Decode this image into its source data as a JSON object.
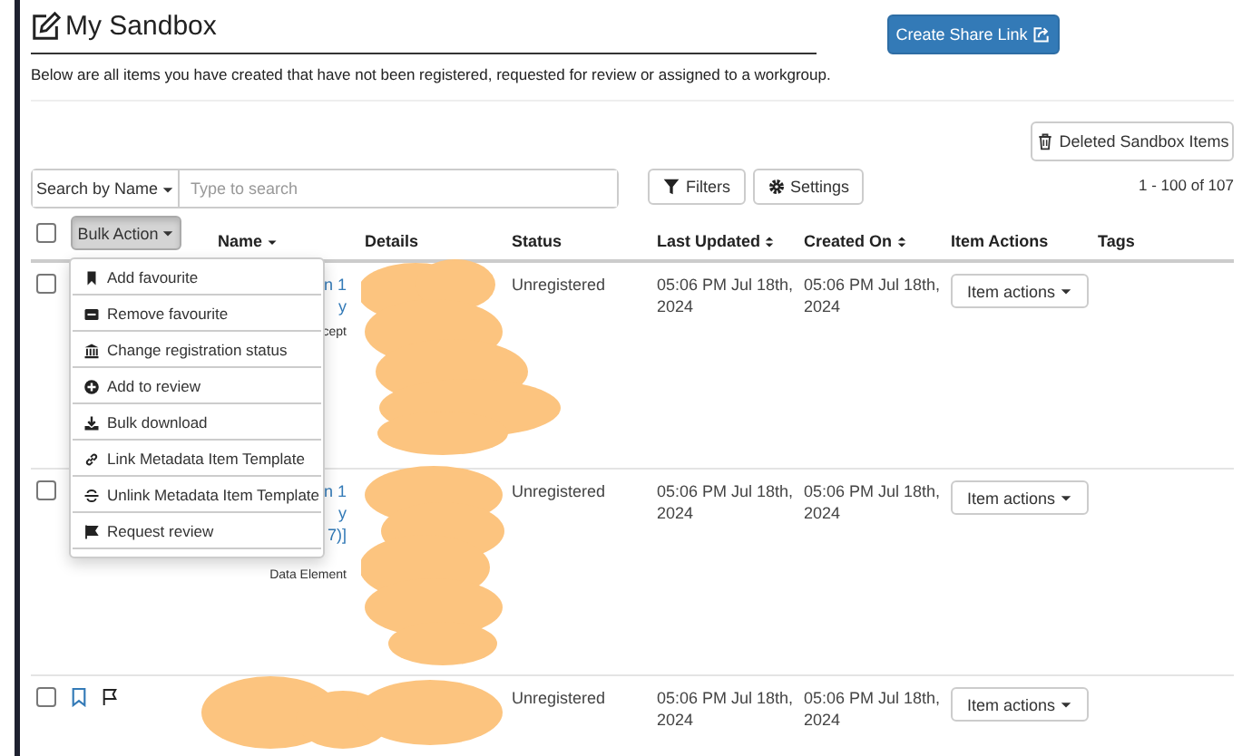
{
  "page": {
    "title": "My Sandbox",
    "description": "Below are all items you have created that have not been registered, requested for review or assigned to a workgroup.",
    "share_button": "Create Share Link",
    "deleted_button": "Deleted Sandbox Items"
  },
  "toolbar": {
    "search_mode": "Search by Name",
    "search_placeholder": "Type to search",
    "filters": "Filters",
    "settings": "Settings",
    "pagination": "1 - 100 of 107"
  },
  "table": {
    "select_all_checked": false,
    "bulk_action": "Bulk Action",
    "bulk_menu_open": true,
    "columns": [
      "Name",
      "Details",
      "Status",
      "Last Updated",
      "Created On",
      "Item Actions",
      "Tags"
    ],
    "rows": [
      {
        "checked": false,
        "redacted": true,
        "name": [
          {
            "text": "n 1",
            "kind": "link"
          },
          {
            "text": "y",
            "kind": "link"
          },
          {
            "text": "cept",
            "kind": "type"
          }
        ],
        "status": "Unregistered",
        "last_updated": "05:06 PM Jul 18th, 2024",
        "created_on": "05:06 PM Jul 18th, 2024",
        "action": "Item actions"
      },
      {
        "checked": false,
        "redacted": true,
        "name": [
          {
            "text": "n 1",
            "kind": "link"
          },
          {
            "text": "y",
            "kind": "link"
          },
          {
            "text": "7)]",
            "kind": "link"
          },
          {
            "text": "Data Element",
            "kind": "type"
          }
        ],
        "status": "Unregistered",
        "last_updated": "05:06 PM Jul 18th, 2024",
        "created_on": "05:06 PM Jul 18th, 2024",
        "action": "Item actions"
      },
      {
        "checked": false,
        "redacted": true,
        "favourite": false,
        "flagged": false,
        "name": [],
        "status": "Unregistered",
        "last_updated": "05:06 PM Jul 18th, 2024",
        "created_on": "05:06 PM Jul 18th, 2024",
        "action": "Item actions"
      }
    ]
  },
  "bulk_menu": [
    "Add favourite",
    "Remove favourite",
    "Change registration status",
    "Add to review",
    "Bulk download",
    "Link Metadata Item Template",
    "Unlink Metadata Item Template",
    "Request review"
  ]
}
